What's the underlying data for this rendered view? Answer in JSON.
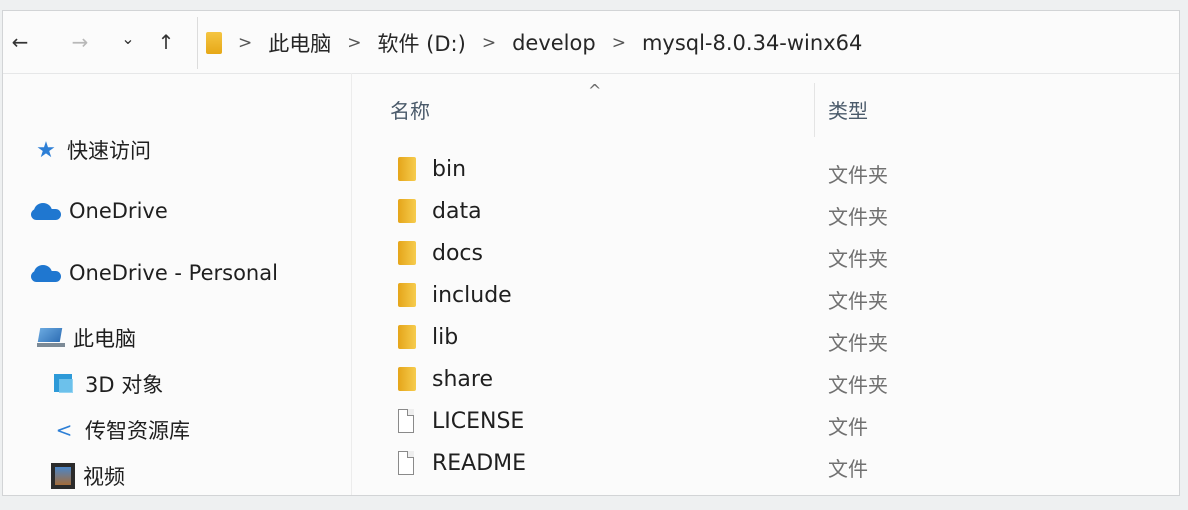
{
  "nav": {
    "back": "←",
    "forward": "→",
    "recent": "⌄",
    "up": "↑"
  },
  "breadcrumb": {
    "separator": ">",
    "items": [
      "此电脑",
      "软件 (D:)",
      "develop",
      "mysql-8.0.34-winx64"
    ]
  },
  "sidebar": {
    "items": [
      {
        "label": "快速访问",
        "icon": "star-icon"
      },
      {
        "label": "OneDrive",
        "icon": "cloud-icon"
      },
      {
        "label": "OneDrive - Personal",
        "icon": "cloud-icon"
      },
      {
        "label": "此电脑",
        "icon": "computer-icon"
      },
      {
        "label": "3D 对象",
        "icon": "cube-icon"
      },
      {
        "label": "传智资源库",
        "icon": "share-icon"
      },
      {
        "label": "视频",
        "icon": "video-icon"
      }
    ]
  },
  "columns": {
    "name": "名称",
    "type": "类型",
    "sort_indicator": "^"
  },
  "files": [
    {
      "name": "bin",
      "type": "文件夹",
      "kind": "folder"
    },
    {
      "name": "data",
      "type": "文件夹",
      "kind": "folder"
    },
    {
      "name": "docs",
      "type": "文件夹",
      "kind": "folder"
    },
    {
      "name": "include",
      "type": "文件夹",
      "kind": "folder"
    },
    {
      "name": "lib",
      "type": "文件夹",
      "kind": "folder"
    },
    {
      "name": "share",
      "type": "文件夹",
      "kind": "folder"
    },
    {
      "name": "LICENSE",
      "type": "文件",
      "kind": "file"
    },
    {
      "name": "README",
      "type": "文件",
      "kind": "file"
    }
  ]
}
